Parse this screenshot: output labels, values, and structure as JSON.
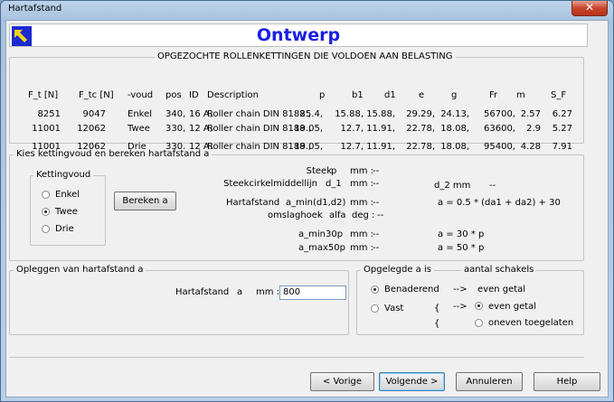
{
  "window": {
    "title": "Hartafstand",
    "close_glyph": "✕"
  },
  "header": {
    "title": "Ontwerp",
    "logo_icon": "arrow-logo-icon"
  },
  "results": {
    "group_title": "OPGEZOCHTE ROLLENKETTINGEN DIE VOLDOEN AAN BELASTING",
    "columns": [
      "F_t  [N]",
      "F_tc  [N]",
      "-voud",
      "pos",
      "ID",
      "Description",
      "p",
      "b1",
      "d1",
      "e",
      "g",
      "Fr",
      "m",
      "S_F"
    ],
    "rows": [
      [
        "8251",
        "9047",
        "Enkel",
        "340,",
        "16 A,",
        "Roller chain DIN 8188 ,",
        "25.4,",
        "15.88,",
        "15.88,",
        "29.29,",
        "24.13,",
        "56700,",
        "2.57",
        "6.27"
      ],
      [
        "11001",
        "12062",
        "Twee",
        "330,",
        "12 A,",
        "Roller chain DIN 8188 ,",
        "19.05,",
        "12.7,",
        "11.91,",
        "22.78,",
        "18.08,",
        "63600,",
        "2.9",
        "5.27"
      ],
      [
        "11001",
        "12062",
        "Drie",
        "330,",
        "12 A,",
        "Roller chain DIN 8188 ,",
        "19.05,",
        "12.7,",
        "11.91,",
        "22.78,",
        "18.08,",
        "95400,",
        "4.28",
        "7.91"
      ]
    ]
  },
  "calc": {
    "group_title": "Kies kettingvoud en bereken hartafstand a",
    "kettingvoud_title": "Kettingvoud",
    "options": [
      {
        "label": "Enkel",
        "selected": false
      },
      {
        "label": "Twee",
        "selected": true
      },
      {
        "label": "Drie",
        "selected": false
      }
    ],
    "bereken_label": "Bereken a",
    "steek_label": "Steek",
    "steek_sym": "p",
    "steek_unit": "mm :",
    "steek_val": "--",
    "steekcirkel_label": "Steekcirkelmiddellijn",
    "steekcirkel_sym": "d_1",
    "steekcirkel_unit": "mm :",
    "steekcirkel_val": "--",
    "d2_label": "d_2   mm",
    "d2_val": "--",
    "hart_label": "Hartafstand",
    "hart_sym": "a_min(d1,d2)",
    "hart_unit": "mm :",
    "hart_val": "--",
    "hart_formula": "a = 0.5 * (da1 + da2) + 30",
    "omslag_label": "omslaghoek",
    "omslag_sym": "alfa",
    "omslag_unit": "deg :",
    "omslag_val": "--",
    "amin30_sym": "a_min30p",
    "amin30_unit": "mm :",
    "amin30_val": "--",
    "amin30_formula": "a = 30 * p",
    "amax50_sym": "a_max50p",
    "amax50_unit": "mm :",
    "amax50_val": "--",
    "amax50_formula": "a = 50 * p"
  },
  "opleggen": {
    "group_title": "Opleggen van hartafstand a",
    "label": "Hartafstand",
    "sym": "a",
    "unit": "mm :",
    "value": "800"
  },
  "opgelegd": {
    "group_title": "Opgelegde a is",
    "schakels_title": "aantal schakels",
    "left_options": [
      {
        "label": "Benaderend",
        "selected": true
      },
      {
        "label": "Vast",
        "selected": false
      }
    ],
    "arrow1": "-->",
    "arrow2": "-->",
    "brace1": "{",
    "brace2": "{",
    "even_getal_text": "even getal",
    "right_options": [
      {
        "label": "even getal",
        "selected": true
      },
      {
        "label": "oneven toegelaten",
        "selected": false
      }
    ]
  },
  "nav": {
    "prev_label": "< Vorige",
    "next_label": "Volgende >",
    "cancel_label": "Annuleren",
    "help_label": "Help"
  }
}
